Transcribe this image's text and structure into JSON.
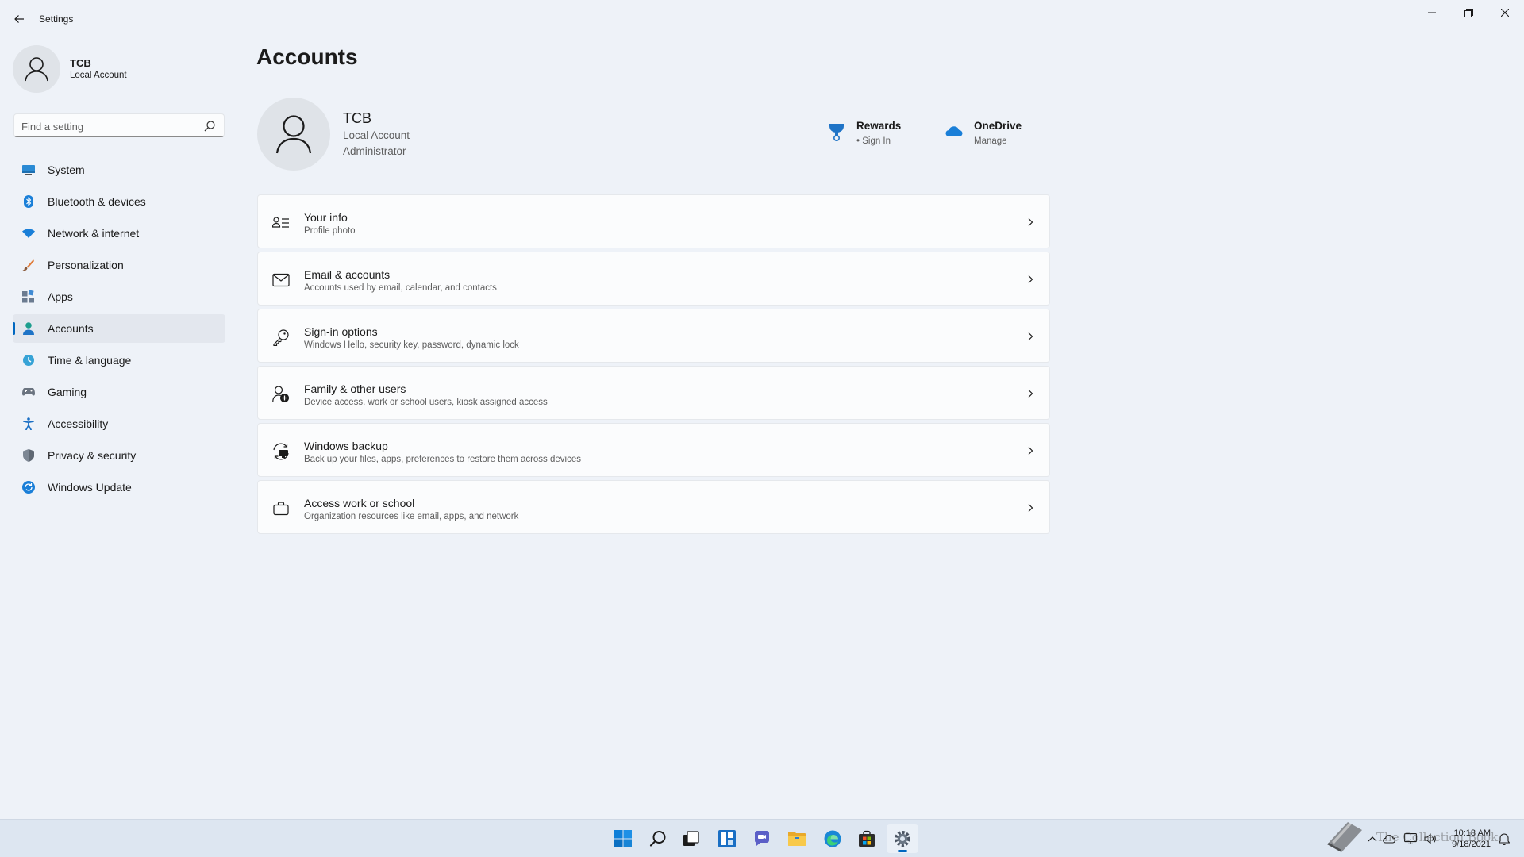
{
  "window": {
    "title": "Settings"
  },
  "sidebar": {
    "user": {
      "name": "TCB",
      "account_type": "Local Account"
    },
    "search": {
      "placeholder": "Find a setting"
    },
    "items": [
      {
        "label": "System",
        "icon": "monitor-icon",
        "active": false
      },
      {
        "label": "Bluetooth & devices",
        "icon": "bluetooth-icon",
        "active": false
      },
      {
        "label": "Network & internet",
        "icon": "wifi-icon",
        "active": false
      },
      {
        "label": "Personalization",
        "icon": "brush-icon",
        "active": false
      },
      {
        "label": "Apps",
        "icon": "apps-icon",
        "active": false
      },
      {
        "label": "Accounts",
        "icon": "person-icon",
        "active": true
      },
      {
        "label": "Time & language",
        "icon": "globe-clock-icon",
        "active": false
      },
      {
        "label": "Gaming",
        "icon": "gamepad-icon",
        "active": false
      },
      {
        "label": "Accessibility",
        "icon": "accessibility-icon",
        "active": false
      },
      {
        "label": "Privacy & security",
        "icon": "shield-icon",
        "active": false
      },
      {
        "label": "Windows Update",
        "icon": "update-icon",
        "active": false
      }
    ]
  },
  "main": {
    "title": "Accounts",
    "account": {
      "name": "TCB",
      "type": "Local Account",
      "role": "Administrator"
    },
    "services": {
      "rewards": {
        "title": "Rewards",
        "sub": "• Sign In",
        "icon": "trophy-icon"
      },
      "onedrive": {
        "title": "OneDrive",
        "sub": "Manage",
        "icon": "cloud-icon"
      }
    },
    "cards": [
      {
        "title": "Your info",
        "sub": "Profile photo",
        "icon": "contact-card-icon"
      },
      {
        "title": "Email & accounts",
        "sub": "Accounts used by email, calendar, and contacts",
        "icon": "mail-icon"
      },
      {
        "title": "Sign-in options",
        "sub": "Windows Hello, security key, password, dynamic lock",
        "icon": "key-icon"
      },
      {
        "title": "Family & other users",
        "sub": "Device access, work or school users, kiosk assigned access",
        "icon": "add-person-icon"
      },
      {
        "title": "Windows backup",
        "sub": "Back up your files, apps, preferences to restore them across devices",
        "icon": "backup-icon"
      },
      {
        "title": "Access work or school",
        "sub": "Organization resources like email, apps, and network",
        "icon": "briefcase-icon"
      }
    ]
  },
  "taskbar": {
    "apps": [
      {
        "name": "Start",
        "icon": "windows-start-icon"
      },
      {
        "name": "Search",
        "icon": "search-icon"
      },
      {
        "name": "Task View",
        "icon": "task-view-icon"
      },
      {
        "name": "Widgets",
        "icon": "widgets-icon"
      },
      {
        "name": "Chat",
        "icon": "chat-icon"
      },
      {
        "name": "File Explorer",
        "icon": "folder-icon"
      },
      {
        "name": "Microsoft Edge",
        "icon": "edge-icon"
      },
      {
        "name": "Microsoft Store",
        "icon": "store-icon"
      },
      {
        "name": "Settings",
        "icon": "gear-icon"
      }
    ],
    "clock": {
      "time": "10:18 AM",
      "date": "9/18/2021"
    }
  },
  "watermark": {
    "text": "The Collection Book"
  },
  "colors": {
    "accent": "#0067c0",
    "background": "#eef2f8",
    "card": "#fbfcfd"
  }
}
